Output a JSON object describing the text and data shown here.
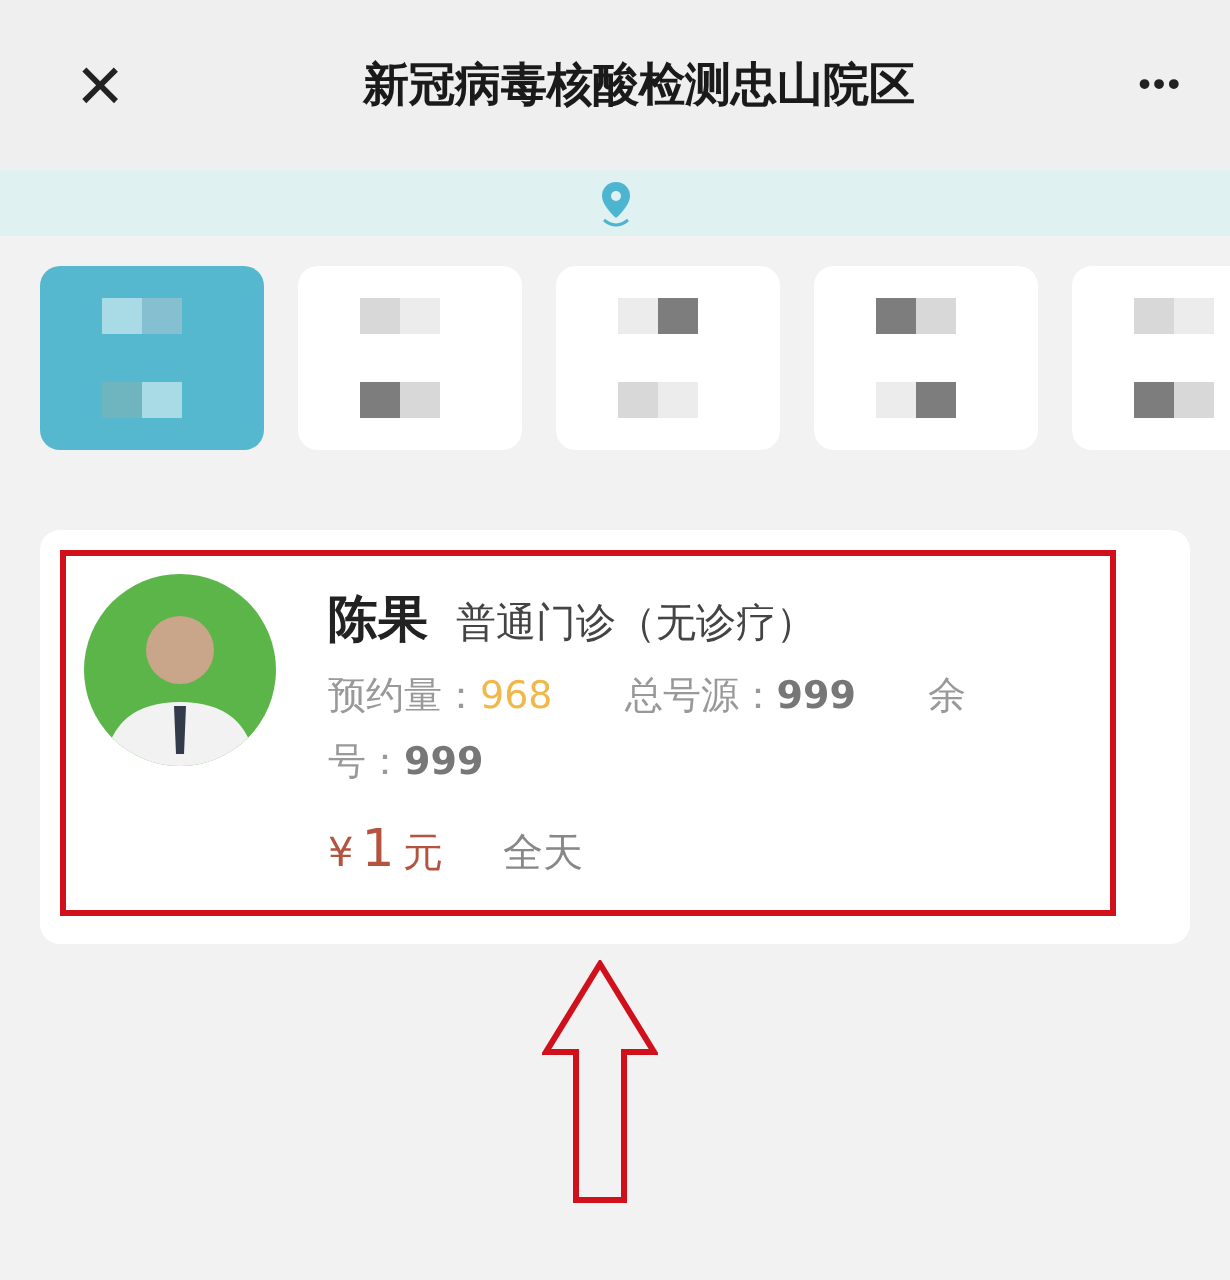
{
  "header": {
    "close": "×",
    "title": "新冠病毒核酸检测忠山院区",
    "more": "•••"
  },
  "date_tiles": [
    {
      "selected": true
    },
    {
      "selected": false
    },
    {
      "selected": false
    },
    {
      "selected": false
    },
    {
      "selected": false
    }
  ],
  "doctor": {
    "name": "陈果",
    "clinic": "普通门诊（无诊疗）",
    "booked_label": "预约量：",
    "booked": "968",
    "total_label": "总号源：",
    "total": "999",
    "remaining_label": "余号：",
    "remaining": "999",
    "price_symbol": "¥",
    "price": "1",
    "price_unit": "元",
    "time": "全天"
  }
}
